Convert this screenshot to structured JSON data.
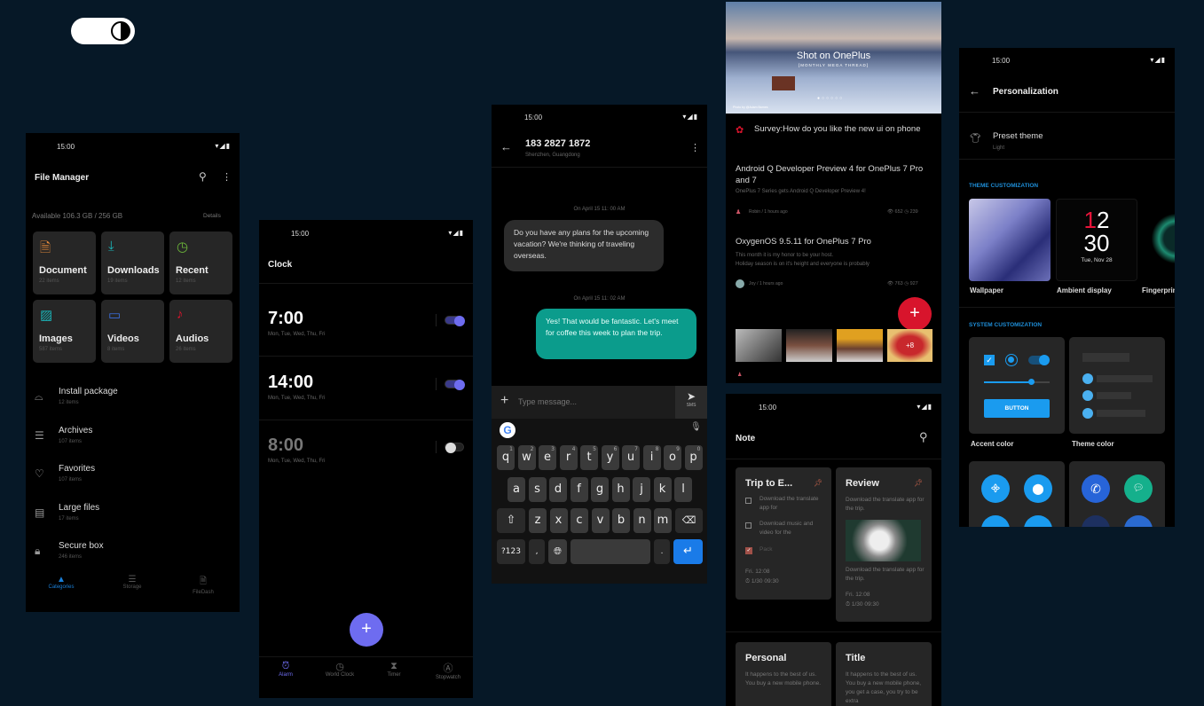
{
  "colors": {
    "background": "#061827",
    "accent_blue": "#1a9bef",
    "clock_purple": "#6e6cf0",
    "teal_bubble": "#0b9c8c",
    "red_fab": "#d8142c"
  },
  "theme_toggle": {
    "icon": "contrast-icon"
  },
  "status": {
    "time": "15:00",
    "icons": "wifi-signal-battery-icons"
  },
  "file_manager": {
    "title": "File Manager",
    "storage": "Available 106.3 GB / 256 GB",
    "details": "Details",
    "tiles": [
      {
        "name": "Document",
        "count": "22 items",
        "icon": "document-icon",
        "color": "#e0873a"
      },
      {
        "name": "Downloads",
        "count": "19 items",
        "icon": "download-icon",
        "color": "#1bb3b7"
      },
      {
        "name": "Recent",
        "count": "12 items",
        "icon": "clock-icon",
        "color": "#6cb63a"
      },
      {
        "name": "Images",
        "count": "587 items",
        "icon": "image-icon",
        "color": "#1bb3b7"
      },
      {
        "name": "Videos",
        "count": "8 items",
        "icon": "video-icon",
        "color": "#3b6fe0"
      },
      {
        "name": "Audios",
        "count": "26 items",
        "icon": "music-note-icon",
        "color": "#d8142c"
      }
    ],
    "list": [
      {
        "name": "Install package",
        "count": "12 items",
        "icon": "android-icon"
      },
      {
        "name": "Archives",
        "count": "107 items",
        "icon": "archive-icon"
      },
      {
        "name": "Favorites",
        "count": "107 items",
        "icon": "heart-icon"
      },
      {
        "name": "Large files",
        "count": "17 items",
        "icon": "large-file-icon"
      },
      {
        "name": "Secure box",
        "count": "246 items",
        "icon": "lock-icon"
      }
    ],
    "nav": [
      {
        "label": "Categories",
        "active": true
      },
      {
        "label": "Storage"
      },
      {
        "label": "FileDash"
      }
    ]
  },
  "clock": {
    "title": "Clock",
    "alarms": [
      {
        "time": "7:00",
        "days": "Mon, Tue, Wed, Thu, Fri",
        "on": true
      },
      {
        "time": "14:00",
        "days": "Mon, Tue, Wed, Thu, Fri",
        "on": true
      },
      {
        "time": "8:00",
        "days": "Mon, Tue, Wed, Thu, Fri",
        "on": false
      }
    ],
    "nav": [
      {
        "label": "Alarm",
        "icon": "alarm-icon",
        "active": true
      },
      {
        "label": "World Clock",
        "icon": "clock-icon"
      },
      {
        "label": "Timer",
        "icon": "hourglass-icon"
      },
      {
        "label": "Stopwatch",
        "icon": "stopwatch-icon"
      }
    ]
  },
  "messages": {
    "contact": "183 2827 1872",
    "location": "Shenzhen, Guangdong",
    "thread": [
      {
        "time": "On April 15 11: 00 AM",
        "text": "Do you have any plans for the upcoming vacation? We're thinking of traveling overseas.",
        "from": "them"
      },
      {
        "time": "On April 15 11: 02 AM",
        "text": "Yes! That would be fantastic. Let's meet for coffee this week to plan the trip.",
        "from": "me"
      }
    ],
    "input_placeholder": "Type message...",
    "send_label": "SMS",
    "keyboard": {
      "row1": [
        "q",
        "w",
        "e",
        "r",
        "t",
        "y",
        "u",
        "i",
        "o",
        "p"
      ],
      "hints": [
        "1",
        "2",
        "3",
        "4",
        "5",
        "6",
        "7",
        "8",
        "9",
        "0"
      ],
      "row2": [
        "a",
        "s",
        "d",
        "f",
        "g",
        "h",
        "j",
        "k",
        "l"
      ],
      "row3": [
        "z",
        "x",
        "c",
        "v",
        "b",
        "n",
        "m"
      ],
      "symbols": "?123",
      "comma": ",",
      "period": "."
    }
  },
  "community": {
    "banner_title": "Shot on OnePlus",
    "banner_subtitle": "[MONTHLY MEGA THREAD]",
    "banner_credit": "Photo by @Adam Barnes",
    "banner_page": 1,
    "banner_pages": 6,
    "survey": "Survey:How do you like the new ui on phone",
    "posts": [
      {
        "title": "Android Q Developer Preview 4 for OnePlus 7 Pro and 7",
        "summary": "OnePlus 7 Series gets Android Q Developer Preview 4!",
        "author": "Robin / 1 hours ago",
        "views": "652",
        "comments": "239"
      },
      {
        "title": "OxygenOS 9.5.11 for OnePlus 7 Pro",
        "summary": "This month it is my honor to be your host.\nHoliday season is on it's height and everyone is probably",
        "author": "Joy / 1 hours ago",
        "views": "763",
        "comments": "927"
      }
    ],
    "more_photos": "+8"
  },
  "notes": {
    "title": "Note",
    "cards": [
      {
        "title": "Trip to E...",
        "checklist": [
          {
            "text": "Download the translate app for",
            "done": false
          },
          {
            "text": "Download music and video for the",
            "done": false
          },
          {
            "text": "Pack",
            "done": true
          }
        ],
        "date": "Fri. 12:08",
        "alarm": "1/30 09:30"
      },
      {
        "title": "Review",
        "text1": "Download the translate app for the trip.",
        "text2": "Download the translate app for the trip.",
        "date": "Fri. 12:08",
        "alarm": "1/30 09:30"
      },
      {
        "title": "Personal",
        "text": "It happens to the best of us. You buy a new mobile phone."
      },
      {
        "title": "Title",
        "text": "It happens to the best of us. You buy a new mobile phone, you get a case, you try to be extra"
      }
    ]
  },
  "personalization": {
    "title": "Personalization",
    "preset_label": "Preset theme",
    "preset_value": "Light",
    "theme_section": "THEME CUSTOMIZATION",
    "theme_items": [
      "Wallpaper",
      "Ambient display",
      "Fingerprint"
    ],
    "ambient": {
      "hour": "12",
      "minute": "30",
      "date": "Tue, Nov 28"
    },
    "system_section": "SYSTEM CUSTOMIZATION",
    "system_items": [
      "Accent color",
      "Theme color"
    ],
    "button_label": "BUTTON",
    "slider_value": 0.72
  }
}
